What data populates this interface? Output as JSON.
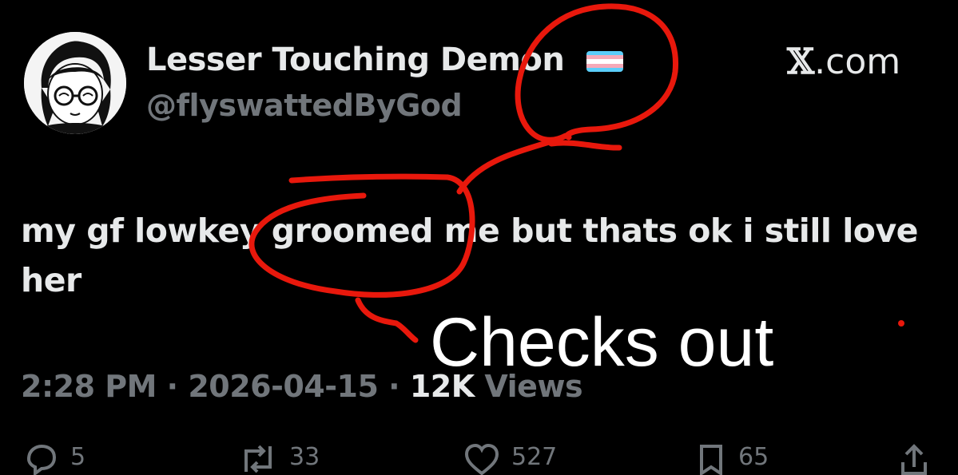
{
  "author": {
    "display_name": "Lesser Touching Demon",
    "handle": "@flyswattedByGod",
    "flag_colors": [
      "#5bcefa",
      "#f5a9b8",
      "#ffffff",
      "#f5a9b8",
      "#5bcefa"
    ]
  },
  "brand": {
    "x_glyph": "𝕏",
    "domain": ".com"
  },
  "tweet": {
    "text": "my gf lowkey groomed me but thats ok i still love her"
  },
  "meta": {
    "time": "2:28 PM",
    "sep1": " · ",
    "date": "2026-04-15",
    "sep2": " · ",
    "views_count": "12K",
    "views_label": " Views"
  },
  "overlay": {
    "caption": "Checks out",
    "scribble_color": "#e8180c"
  },
  "actions": {
    "replies": "5",
    "reposts": "33",
    "likes": "527",
    "bookmarks": "65"
  }
}
